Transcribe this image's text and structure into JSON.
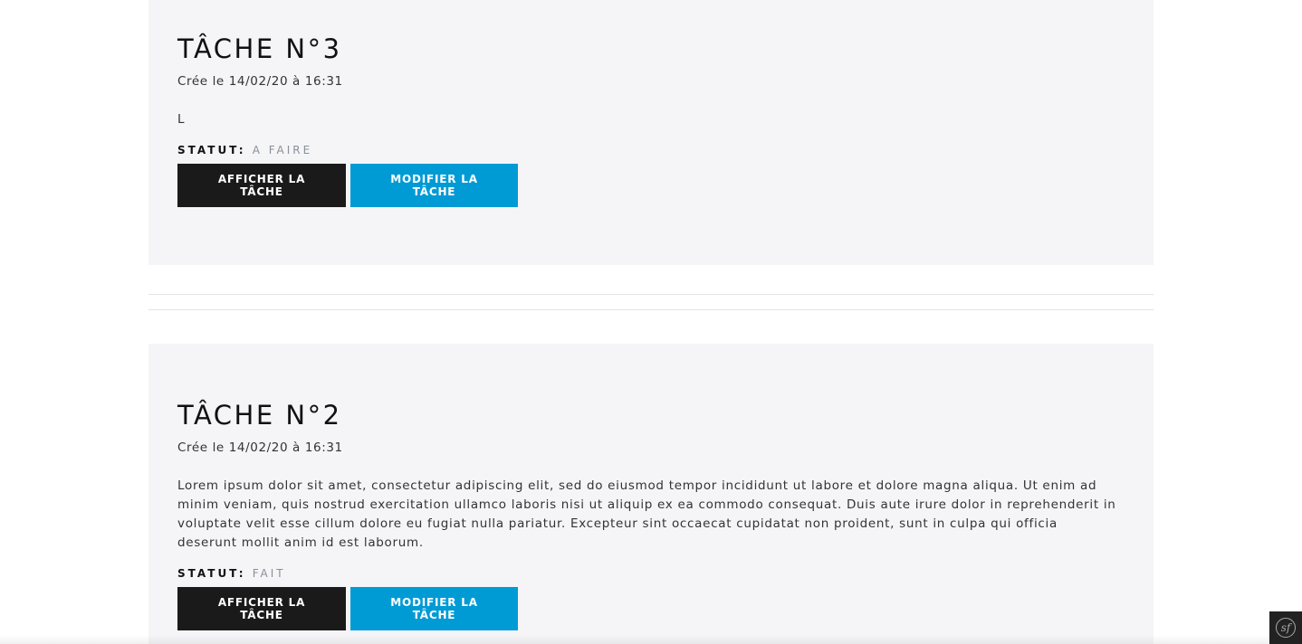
{
  "tasks": [
    {
      "title": "TÂCHE N°3",
      "date": "Crée le 14/02/20 à 16:31",
      "content": "L",
      "status_label": "STATUT:",
      "status_value": "A FAIRE",
      "show_button": "AFFICHER LA TÂCHE",
      "edit_button": "MODIFIER LA TÂCHE"
    },
    {
      "title": "TÂCHE N°2",
      "date": "Crée le 14/02/20 à 16:31",
      "content": "Lorem ipsum dolor sit amet, consectetur adipiscing elit, sed do eiusmod tempor incididunt ut labore et dolore magna aliqua. Ut enim ad minim veniam, quis nostrud exercitation ullamco laboris nisi ut aliquip ex ea commodo consequat. Duis aute irure dolor in reprehenderit in voluptate velit esse cillum dolore eu fugiat nulla pariatur. Excepteur sint occaecat cupidatat non proident, sunt in culpa qui officia deserunt mollit anim id est laborum.",
      "status_label": "STATUT:",
      "status_value": "FAIT",
      "show_button": "AFFICHER LA TÂCHE",
      "edit_button": "MODIFIER LA TÂCHE"
    }
  ],
  "toolbar": {
    "logo_text": "sf",
    "icon": "symfony-icon"
  },
  "colors": {
    "card_background": "#f5f5f7",
    "show_button": "#1a1a1a",
    "edit_button": "#009bd5",
    "status_value": "#8a8f99"
  }
}
